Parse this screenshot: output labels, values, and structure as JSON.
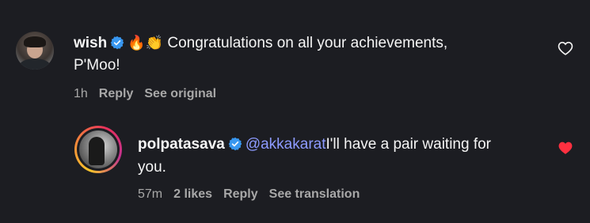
{
  "comments": [
    {
      "username": "wish",
      "emojis": "🔥👏",
      "text": "Congratulations on all your achievements,",
      "text_line2": "P'Moo!",
      "time": "1h",
      "reply_label": "Reply",
      "see_label": "See original",
      "liked": false
    },
    {
      "username": "polpatasava",
      "mention": "@akkakarat",
      "text": "I'll have a pair waiting for",
      "text_line2": "you.",
      "time": "57m",
      "likes": "2 likes",
      "reply_label": "Reply",
      "see_label": "See translation",
      "liked": true
    }
  ],
  "colors": {
    "background": "#1c1d22",
    "verified": "#3897f0",
    "mention": "#8d9bff",
    "liked_heart": "#ff3040",
    "meta": "#a8a8a8"
  },
  "icons": [
    "verified-badge-icon",
    "heart-outline-icon",
    "heart-filled-icon",
    "fire-emoji",
    "clapping-hands-emoji"
  ]
}
